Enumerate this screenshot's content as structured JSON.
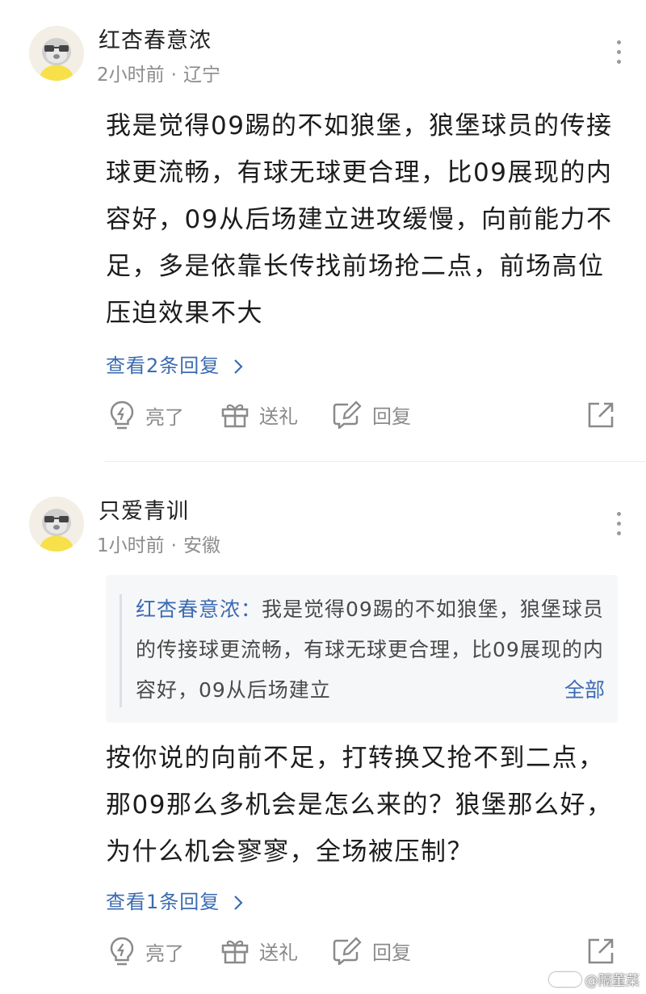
{
  "comments": [
    {
      "username": "红杏春意浓",
      "time": "2小时前",
      "location": "辽宁",
      "text": "我是觉得09踢的不如狼堡，狼堡球员的传接球更流畅，有球无球更合理，比09展现的内容好，09从后场建立进攻缓慢，向前能力不足，多是依靠长传找前场抢二点，前场高位压迫效果不大",
      "replies_link": "查看2条回复",
      "actions": {
        "like": "亮了",
        "gift": "送礼",
        "reply": "回复"
      }
    },
    {
      "username": "只爱青训",
      "time": "1小时前",
      "location": "安徽",
      "quote": {
        "name": "红杏春意浓：",
        "text": "我是觉得09踢的不如狼堡，狼堡球员的传接球更流畅，有球无球更合理，比09展现的内容好，09从后场建立",
        "expand": "全部"
      },
      "text": "按你说的向前不足，打转换又抢不到二点，那09那么多机会是怎么来的？狼堡那么好，为什么机会寥寥，全场被压制？",
      "replies_link": "查看1条回复",
      "actions": {
        "like": "亮了",
        "gift": "送礼",
        "reply": "回复"
      }
    }
  ],
  "separator": "·",
  "watermark": "@隔董菜",
  "colors": {
    "link": "#3b6bb2",
    "meta": "#8c8c8c",
    "quote_bg": "#f6f7f9"
  },
  "icons": [
    "more-vertical-icon",
    "lightbulb-icon",
    "gift-icon",
    "edit-reply-icon",
    "share-icon",
    "chevron-right-icon"
  ]
}
